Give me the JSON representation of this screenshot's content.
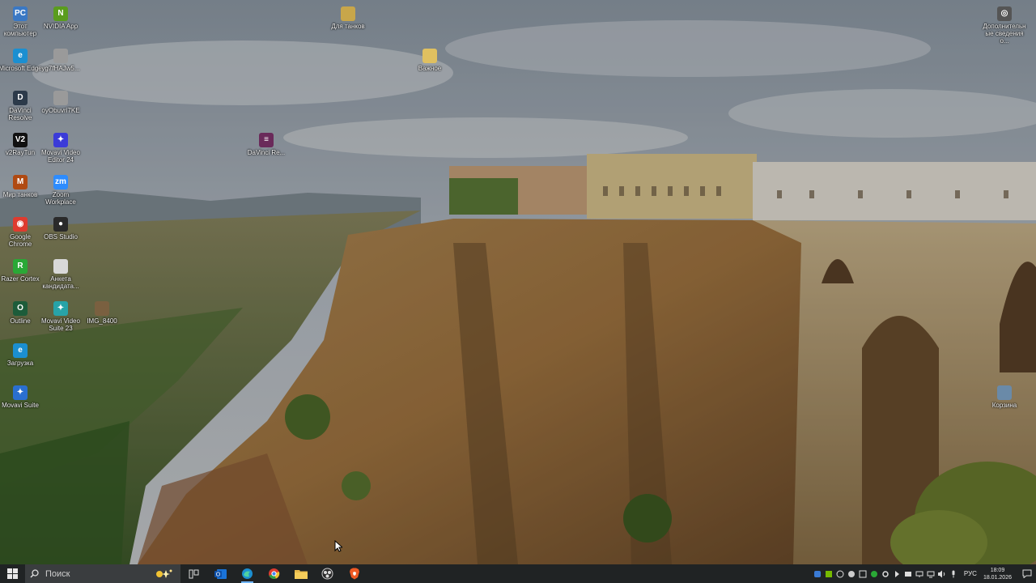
{
  "desktop": {
    "icons": [
      {
        "id": "this-pc",
        "label": "Этот компьютер",
        "glyph": "PC",
        "color": "#3a78c4"
      },
      {
        "id": "nvidia",
        "label": "NVIDIA App",
        "glyph": "N",
        "color": "#5a9c1e"
      },
      {
        "id": "edge",
        "label": "Microsoft Edge",
        "glyph": "e",
        "color": "#1b8fd1"
      },
      {
        "id": "file-yg",
        "label": "yg7fHAJw5...",
        "glyph": "",
        "color": "#9a9a9a"
      },
      {
        "id": "davinci",
        "label": "DaVinci Resolve",
        "glyph": "D",
        "color": "#2c3a4a"
      },
      {
        "id": "file-oy",
        "label": "oyObuvri7KE",
        "glyph": "",
        "color": "#9a9a9a"
      },
      {
        "id": "v2rayn",
        "label": "v2RayTun",
        "glyph": "V2",
        "color": "#111111"
      },
      {
        "id": "movavi24",
        "label": "Movavi Video Editor 24",
        "glyph": "✦",
        "color": "#3b3bd8"
      },
      {
        "id": "mir-tankov",
        "label": "Мир танков",
        "glyph": "M",
        "color": "#b04a12"
      },
      {
        "id": "zoom",
        "label": "Zoom Workplace",
        "glyph": "zm",
        "color": "#2d8cff"
      },
      {
        "id": "chrome",
        "label": "Google Chrome",
        "glyph": "◉",
        "color": "#de3b2f"
      },
      {
        "id": "obs",
        "label": "OBS Studio",
        "glyph": "●",
        "color": "#2a2a2a"
      },
      {
        "id": "razer",
        "label": "Razer Cortex",
        "glyph": "R",
        "color": "#2aa836"
      },
      {
        "id": "anketa",
        "label": "Анкета кандидата...",
        "glyph": "",
        "color": "#d8d8d8"
      },
      {
        "id": "outline",
        "label": "Outline",
        "glyph": "O",
        "color": "#1d5c3a"
      },
      {
        "id": "movavi23",
        "label": "Movavi Video Suite 23",
        "glyph": "✦",
        "color": "#27a3a8"
      },
      {
        "id": "img",
        "label": "IMG_8400",
        "glyph": "",
        "color": "#7a6040"
      },
      {
        "id": "zagruzka",
        "label": "Загрузка",
        "glyph": "e",
        "color": "#1b8fd1"
      },
      {
        "id": "movavi-suite",
        "label": "Movavi Suite",
        "glyph": "✦",
        "color": "#2a6fd0"
      },
      {
        "id": "dlya-tankov",
        "label": "Для танков",
        "glyph": "",
        "color": "#c8a64a"
      },
      {
        "id": "vazhnoe",
        "label": "Важное",
        "glyph": "",
        "color": "#e0c060"
      },
      {
        "id": "davinci-re",
        "label": "DaVinci Re...",
        "glyph": "≡",
        "color": "#6a2a5a"
      },
      {
        "id": "dop-svedeniya",
        "label": "Дополнительные сведения о...",
        "glyph": "◎",
        "color": "#555555"
      },
      {
        "id": "korzina",
        "label": "Корзина",
        "glyph": "",
        "color": "#6a8aa8"
      }
    ]
  },
  "taskbar": {
    "search_placeholder": "Поиск",
    "apps": [
      {
        "id": "task-view",
        "icon": "task-view-icon"
      },
      {
        "id": "outlook",
        "icon": "outlook-icon"
      },
      {
        "id": "edge",
        "icon": "edge-icon",
        "active": true
      },
      {
        "id": "chrome",
        "icon": "chrome-icon"
      },
      {
        "id": "explorer",
        "icon": "folder-icon"
      },
      {
        "id": "obs",
        "icon": "obs-icon"
      },
      {
        "id": "brave",
        "icon": "brave-icon"
      }
    ],
    "tray": {
      "language": "РУС",
      "time": "18:09",
      "date": "18.01.2026"
    }
  }
}
